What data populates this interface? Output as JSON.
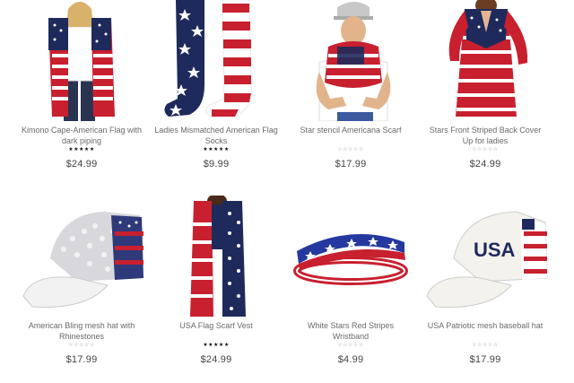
{
  "products": [
    {
      "title": "Kimono Cape-American Flag with dark piping",
      "price": "$24.99",
      "rating": "★★★★★",
      "rated": true
    },
    {
      "title": "Ladies Mismatched American Flag Socks",
      "price": "$9.99",
      "rating": "★★★★★",
      "rated": true
    },
    {
      "title": "Star stencil Americana Scarf",
      "price": "$17.99",
      "rating": "☆☆☆☆☆",
      "rated": false
    },
    {
      "title": "Stars Front Striped Back Cover Up for ladies",
      "price": "$24.99",
      "rating": "☆☆☆☆☆",
      "rated": false
    },
    {
      "title": "American Bling mesh hat with Rhinestones",
      "price": "$17.99",
      "rating": "☆☆☆☆☆",
      "rated": false
    },
    {
      "title": "USA Flag Scarf Vest",
      "price": "$24.99",
      "rating": "★★★★★",
      "rated": true
    },
    {
      "title": "White Stars Red Stripes Wristband",
      "price": "$4.99",
      "rating": "☆☆☆☆☆",
      "rated": false
    },
    {
      "title": "USA Patriotic mesh baseball hat",
      "price": "$17.99",
      "rating": "☆☆☆☆☆",
      "rated": false
    }
  ],
  "images": {
    "hat_text": "USA"
  },
  "colors": {
    "red": "#c8202f",
    "navy": "#1f2a5c",
    "white": "#ffffff"
  }
}
